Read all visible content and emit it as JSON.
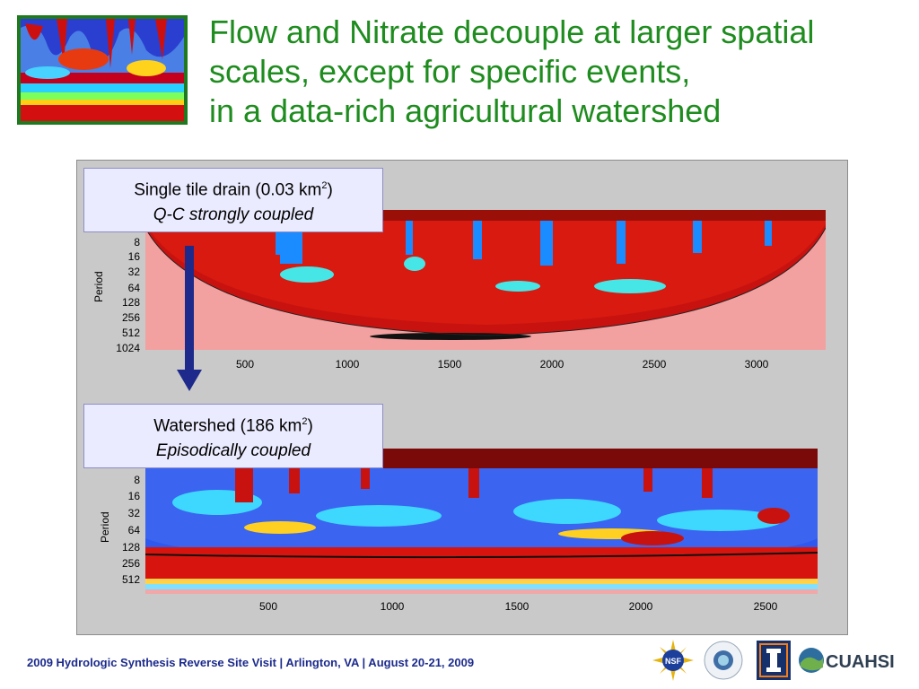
{
  "title": {
    "line1": "Flow and Nitrate decouple at larger spatial",
    "line2": "scales, except for specific events,",
    "line3": "in a data-rich agricultural watershed"
  },
  "top_plot": {
    "label_line1": "Single tile drain (0.03 km",
    "label_sup": "2",
    "label_close": ")",
    "label_line2": "Q-C strongly coupled",
    "ylabel": "Period",
    "yticks": [
      "8",
      "16",
      "32",
      "64",
      "128",
      "256",
      "512",
      "1024"
    ],
    "xticks": [
      "500",
      "1000",
      "1500",
      "2000",
      "2500",
      "3000"
    ]
  },
  "bottom_plot": {
    "label_line1": "Watershed (186 km",
    "label_sup": "2",
    "label_close": ")",
    "label_line2": "Episodically coupled",
    "ylabel": "Period",
    "yticks": [
      "8",
      "16",
      "32",
      "64",
      "128",
      "256",
      "512"
    ],
    "xticks": [
      "500",
      "1000",
      "1500",
      "2000",
      "2500"
    ]
  },
  "footer": {
    "text": "2009 Hydrologic Synthesis Reverse Site Visit | Arlington, VA | August 20-21, 2009"
  },
  "logos": {
    "nsf": "NSF",
    "cuahsi": "CUAHSI"
  },
  "colors": {
    "title": "#1e8c1e",
    "footer": "#1c2b8c",
    "arrow": "#1d2a8c"
  }
}
